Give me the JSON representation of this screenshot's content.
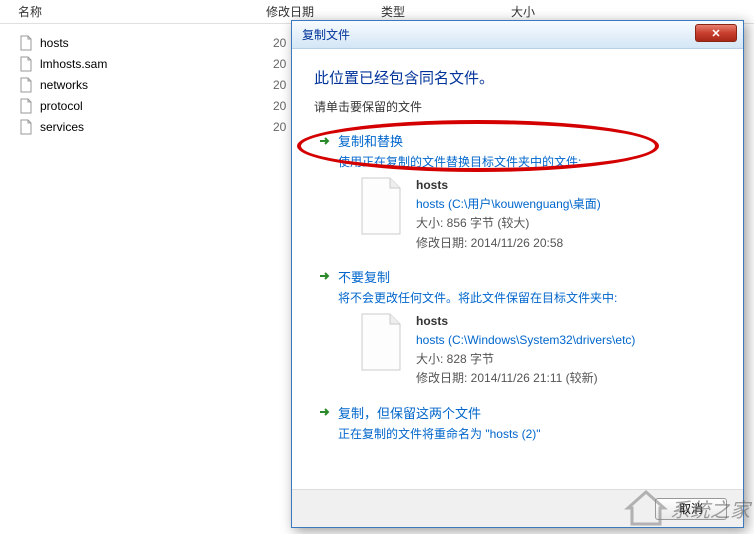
{
  "explorer": {
    "columns": {
      "name": "名称",
      "date": "修改日期",
      "type": "类型",
      "size": "大小"
    },
    "files": [
      {
        "name": "hosts",
        "date": "20"
      },
      {
        "name": "lmhosts.sam",
        "date": "20"
      },
      {
        "name": "networks",
        "date": "20"
      },
      {
        "name": "protocol",
        "date": "20"
      },
      {
        "name": "services",
        "date": "20"
      }
    ]
  },
  "dialog": {
    "title": "复制文件",
    "heading": "此位置已经包含同名文件。",
    "subtext": "请单击要保留的文件",
    "option1": {
      "title": "复制和替换",
      "desc": "使用正在复制的文件替换目标文件夹中的文件:",
      "filename": "hosts",
      "path": "hosts (C:\\用户\\kouwenguang\\桌面)",
      "size": "大小: 856 字节 (较大)",
      "mdate": "修改日期: 2014/11/26 20:58"
    },
    "option2": {
      "title": "不要复制",
      "desc": "将不会更改任何文件。将此文件保留在目标文件夹中:",
      "filename": "hosts",
      "path": "hosts (C:\\Windows\\System32\\drivers\\etc)",
      "size": "大小: 828 字节",
      "mdate": "修改日期: 2014/11/26 21:11 (较新)"
    },
    "option3": {
      "title": "复制，但保留这两个文件",
      "desc": "正在复制的文件将重命名为 \"hosts (2)\""
    },
    "cancel": "取消"
  },
  "watermark": "系统之家"
}
